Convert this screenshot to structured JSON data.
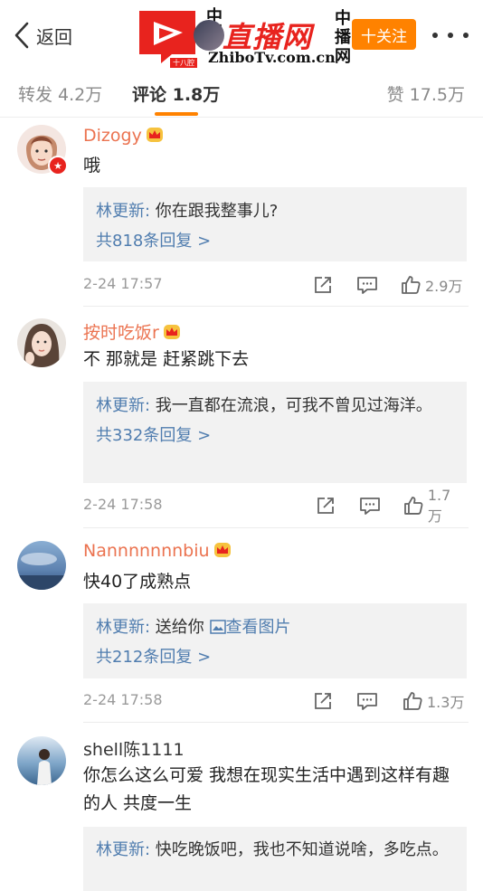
{
  "header": {
    "back_label": "返回",
    "follow_label": "十关注",
    "logo": {
      "cn_left": "中国",
      "main": "直播网",
      "url": "ZhiboTv.com.cn",
      "cn_right": "中播网",
      "sub": "十八腔"
    }
  },
  "tabs": {
    "repost": "转发 4.2万",
    "comment": "评论 1.8万",
    "like": "赞 17.5万"
  },
  "comments": [
    {
      "user": "Dizogy",
      "text": "哦",
      "reply_author": "林更新:",
      "reply_text": " 你在跟我整事儿?",
      "reply_count": "共818条回复 >",
      "date": "2-24 17:57",
      "likes": "2.9万"
    },
    {
      "user": "按时吃饭r",
      "text": "不  那就是  赶紧跳下去",
      "reply_author": "林更新:",
      "reply_text": " 我一直都在流浪，可我不曾见过海洋。",
      "reply_count": "共332条回复 >",
      "date": "2-24 17:58",
      "likes": "1.7万"
    },
    {
      "user": "Nannnnnnnbiu",
      "text": "快40了成熟点",
      "reply_author": "林更新:",
      "reply_text": " 送给你 ",
      "reply_image_link": "查看图片",
      "reply_count": "共212条回复 >",
      "date": "2-24 17:58",
      "likes": "1.3万"
    },
    {
      "user": "shell陈1111",
      "text": "你怎么这么可爱 我想在现实生活中遇到这样有趣的人 共度一生",
      "reply_author": "林更新:",
      "reply_text": " 快吃晚饭吧，我也不知道说啥，多吃点。"
    }
  ],
  "colors": {
    "accent": "#ff8200",
    "username": "#eb7350",
    "link": "#507daf"
  }
}
